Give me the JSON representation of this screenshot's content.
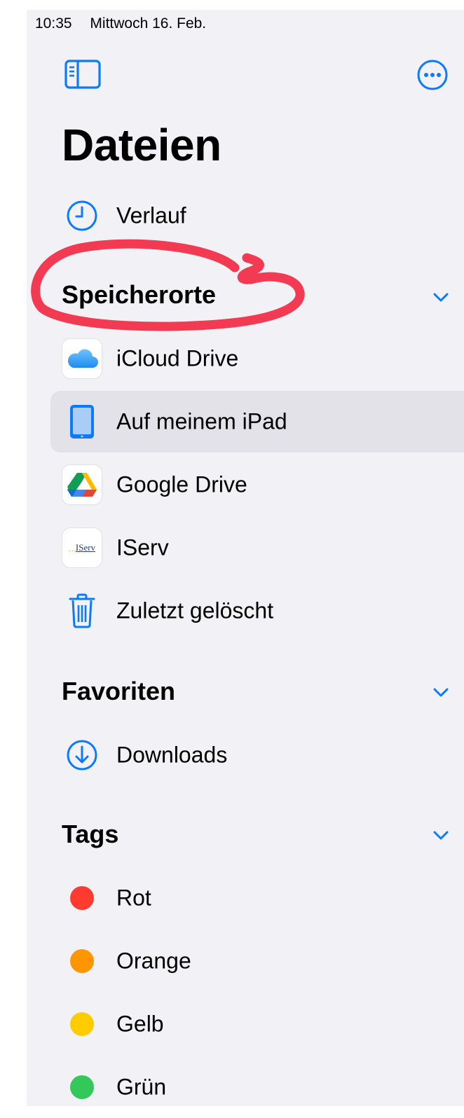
{
  "status_bar": {
    "time": "10:35",
    "date": "Mittwoch 16. Feb."
  },
  "toolbar": {
    "sidebar_icon": "sidebar-toggle-icon",
    "more_icon": "ellipsis-circle-icon"
  },
  "header": {
    "title": "Dateien"
  },
  "recents": {
    "label": "Verlauf",
    "icon": "clock-icon"
  },
  "locations": {
    "title": "Speicherorte",
    "items": [
      {
        "label": "iCloud Drive",
        "icon": "icloud-icon"
      },
      {
        "label": "Auf meinem iPad",
        "icon": "ipad-icon",
        "selected": true
      },
      {
        "label": "Google Drive",
        "icon": "google-drive-icon"
      },
      {
        "label": "IServ",
        "icon": "iserv-icon",
        "logo_text": "IServ"
      },
      {
        "label": "Zuletzt gelöscht",
        "icon": "trash-icon"
      }
    ]
  },
  "favorites": {
    "title": "Favoriten",
    "items": [
      {
        "label": "Downloads",
        "icon": "download-circle-icon"
      }
    ]
  },
  "tags": {
    "title": "Tags",
    "items": [
      {
        "label": "Rot",
        "color": "#ff3b30"
      },
      {
        "label": "Orange",
        "color": "#ff9500"
      },
      {
        "label": "Gelb",
        "color": "#ffcc00"
      },
      {
        "label": "Grün",
        "color": "#34c759"
      }
    ]
  },
  "colors": {
    "accent": "#0a7aff",
    "annotation": "#f23a52",
    "selected_bg": "#e3e2e8",
    "panel_bg": "#f2f1f6"
  }
}
